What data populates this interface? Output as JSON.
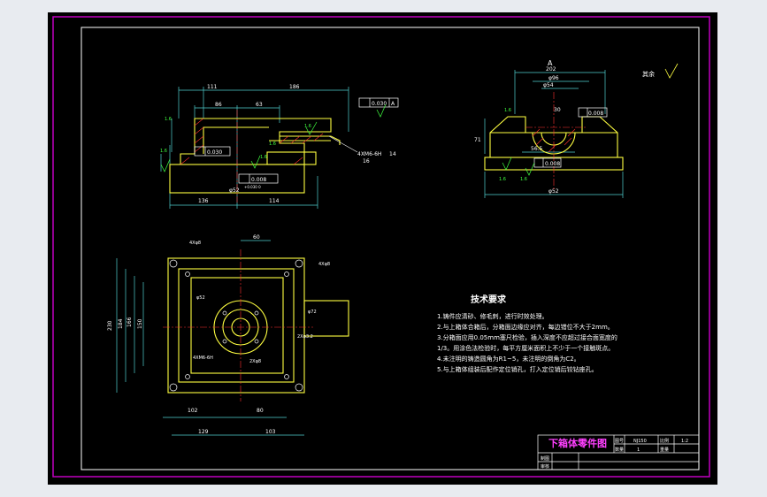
{
  "colors": {
    "background": "#000000",
    "frame": "#c000c0",
    "line": "#ffffff",
    "dim": "#4fd0d0",
    "part": "#ffff40",
    "hatch": "#ff3030",
    "annot": "#40ff40",
    "title": "#ff40ff"
  },
  "front_view": {
    "dims": [
      "111",
      "186",
      "86",
      "63",
      "136",
      "114"
    ],
    "tol": [
      "0.030",
      "A",
      "0.030",
      "0.008"
    ],
    "rough": [
      "1.6",
      "1.6",
      "1.6",
      "1.6",
      "1.6"
    ],
    "thread": "4XM6-6H",
    "depth": "14",
    "thread_depth": "16",
    "bore": "φ52",
    "bore_tol": "+0.030 0"
  },
  "side_view": {
    "section": "A",
    "dims": [
      "202",
      "φ96",
      "φ54",
      "30",
      "56.5",
      "71",
      "φ52"
    ],
    "tol": [
      "0.008",
      "0.008"
    ],
    "rough": [
      "1.6",
      "1.6",
      "1.6"
    ]
  },
  "plan_view": {
    "dims": [
      "60",
      "230",
      "184",
      "166",
      "150",
      "102",
      "80",
      "129",
      "103"
    ],
    "labels": [
      "4Xφ8",
      "4Xφ8",
      "φ52",
      "φ72",
      "4XM6-6H",
      "2Xφ3.2",
      "2Xφ8"
    ]
  },
  "remaining": {
    "label": "其余",
    "symbol": "√"
  },
  "requirements": {
    "title": "技术要求",
    "items": [
      "1.铸件应清砂、修毛刺，进行时效处理。",
      "2.与上箱体合箱后，分箱面边缘应对齐，每边错位不大于2mm。",
      "3.分箱面应用0.05mm塞尺检验，插入深度不应超过接合面宽度的",
      "1/3。用涂色法检验时，每平方厘米面积上不少于一个接触斑点。",
      "4.未注明的铸造圆角为R1~5，未注明的倒角为C2。",
      "5.与上箱体组装后配作定位销孔，打入定位销后铰钻座孔。"
    ]
  },
  "title_block": {
    "name": "下箱体零件图",
    "cells": [
      "图号",
      "NJ150",
      "比例",
      "1:2",
      "数量",
      "1",
      "重量"
    ],
    "designer": "制图",
    "checker": "审核"
  }
}
